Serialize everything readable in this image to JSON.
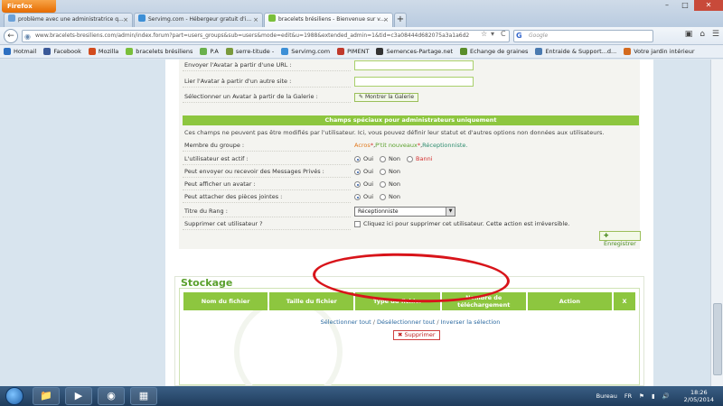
{
  "browser": {
    "menu_label": "Firefox",
    "window_controls": [
      "–",
      "□",
      "✕"
    ],
    "tabs": [
      {
        "label": "problème avec une administratrice q...",
        "color": "#6aa0d8",
        "active": false
      },
      {
        "label": "Servimg.com - Hébergeur gratuit d'i...",
        "color": "#3d8fd6",
        "active": false
      },
      {
        "label": "bracelets brésiliens - Bienvenue sur v...",
        "color": "#7abf3a",
        "active": true
      }
    ],
    "new_tab": "+",
    "back": "←",
    "url": "www.bracelets-bresiliens.com/admin/index.forum?part=users_groups&sub=users&mode=edit&u=1988&extended_admin=1&tid=c3a08444d682075a3a1a6d2",
    "search_engine": "G",
    "search_placeholder": "Google",
    "nav_tools": [
      "▣",
      "⌂",
      "☰"
    ],
    "url_controls": [
      "☆",
      "▾",
      "C"
    ]
  },
  "bookmarks": [
    {
      "label": "Hotmail",
      "color": "#2d6fc1"
    },
    {
      "label": "Facebook",
      "color": "#3b5998"
    },
    {
      "label": "Mozilla",
      "color": "#d24b1e"
    },
    {
      "label": "bracelets brésiliens",
      "color": "#7abf3a"
    },
    {
      "label": "P.A",
      "color": "#6ab04c"
    },
    {
      "label": "serre-titude -",
      "color": "#7a9a3c"
    },
    {
      "label": "Servimg.com",
      "color": "#3d8fd6"
    },
    {
      "label": "PIMENT",
      "color": "#c0392b"
    },
    {
      "label": "Semences-Partage.net",
      "color": "#333333"
    },
    {
      "label": "Echange de graines",
      "color": "#5a8d2a"
    },
    {
      "label": "Entraide & Support...d...",
      "color": "#4a7ab0"
    },
    {
      "label": "Votre jardin intérieur",
      "color": "#d46a1e"
    }
  ],
  "avatar_rows": [
    {
      "label": "Envoyer l'Avatar à partir d'une URL :"
    },
    {
      "label": "Lier l'Avatar à partir d'un autre site :"
    },
    {
      "label": "Sélectionner un Avatar à partir de la Galerie :",
      "button": "Montrer la Galerie"
    }
  ],
  "admin_section": {
    "header": "Champs spéciaux pour administrateurs uniquement",
    "note": "Ces champs ne peuvent pas être modifiés par l'utilisateur. Ici, vous pouvez définir leur statut et d'autres options non données aux utilisateurs.",
    "group_label": "Membre du groupe :",
    "groups": [
      {
        "name": "Acros",
        "star": " *",
        "sep": ", "
      },
      {
        "name": "P'tit nouveaux",
        "star": " *",
        "sep": ", "
      },
      {
        "name": "Réceptionniste.",
        "star": "",
        "sep": ""
      }
    ],
    "active_label": "L'utilisateur est actif :",
    "active_options": [
      "Oui",
      "Non",
      "Banni"
    ],
    "pm_label": "Peut envoyer ou recevoir des Messages Privés :",
    "avatar_label": "Peut afficher un avatar :",
    "attach_label": "Peut attacher des pièces jointes :",
    "yes": "Oui",
    "no": "Non",
    "rank_label": "Titre du Rang :",
    "rank_value": "Réceptionniste",
    "delete_label": "Supprimer cet utilisateur ?",
    "delete_text": "Cliquez ici pour supprimer cet utilisateur. Cette action est irréversible.",
    "save": "Enregistrer"
  },
  "storage": {
    "title": "Stockage",
    "columns": [
      "Nom du fichier",
      "Taille du fichier",
      "Type du fichier",
      "Nombre de téléchargement",
      "Action",
      "X"
    ],
    "link_select_all": "Sélectionner tout",
    "link_deselect_all": "Désélectionner tout",
    "link_invert": "Inverser la sélection",
    "delete": "Supprimer"
  },
  "taskbar": {
    "desktop": "Bureau",
    "lang": "FR",
    "time": "18:26",
    "date": "2/05/2014"
  }
}
